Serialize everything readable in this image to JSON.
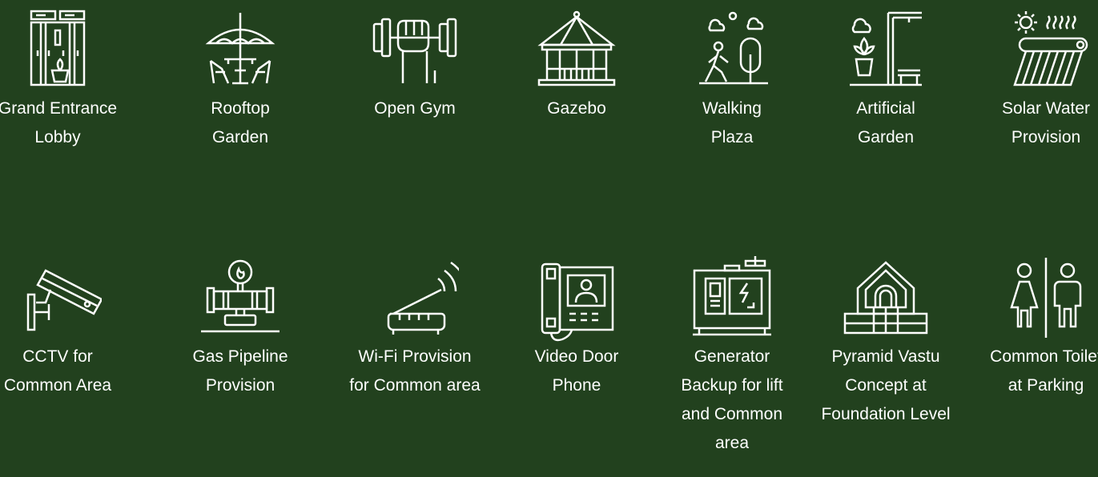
{
  "colors": {
    "background": "#22411e",
    "foreground": "#ffffff"
  },
  "amenities_row1": [
    {
      "icon": "lobby-icon",
      "label_lines": [
        "Grand Entrance",
        "Lobby"
      ]
    },
    {
      "icon": "rooftop-garden-icon",
      "label_lines": [
        "Rooftop",
        "Garden"
      ]
    },
    {
      "icon": "gym-icon",
      "label_lines": [
        "Open Gym"
      ]
    },
    {
      "icon": "gazebo-icon",
      "label_lines": [
        "Gazebo"
      ]
    },
    {
      "icon": "walking-plaza-icon",
      "label_lines": [
        "Walking",
        "Plaza"
      ]
    },
    {
      "icon": "artificial-garden-icon",
      "label_lines": [
        "Artificial",
        "Garden"
      ]
    },
    {
      "icon": "solar-water-icon",
      "label_lines": [
        "Solar Water",
        "Provision"
      ]
    }
  ],
  "amenities_row2": [
    {
      "icon": "cctv-icon",
      "label_lines": [
        "CCTV for",
        "Common Area"
      ]
    },
    {
      "icon": "gas-pipeline-icon",
      "label_lines": [
        "Gas Pipeline",
        "Provision"
      ]
    },
    {
      "icon": "wifi-router-icon",
      "label_lines": [
        "Wi-Fi Provision",
        "for Common area"
      ]
    },
    {
      "icon": "video-door-phone-icon",
      "label_lines": [
        "Video Door",
        "Phone"
      ]
    },
    {
      "icon": "generator-icon",
      "label_lines": [
        "Generator",
        "Backup for lift",
        "and Common",
        "area"
      ]
    },
    {
      "icon": "pyramid-vastu-icon",
      "label_lines": [
        "Pyramid Vastu",
        "Concept at",
        "Foundation Level"
      ]
    },
    {
      "icon": "toilet-icon",
      "label_lines": [
        "Common Toilet",
        "at Parking"
      ]
    }
  ]
}
